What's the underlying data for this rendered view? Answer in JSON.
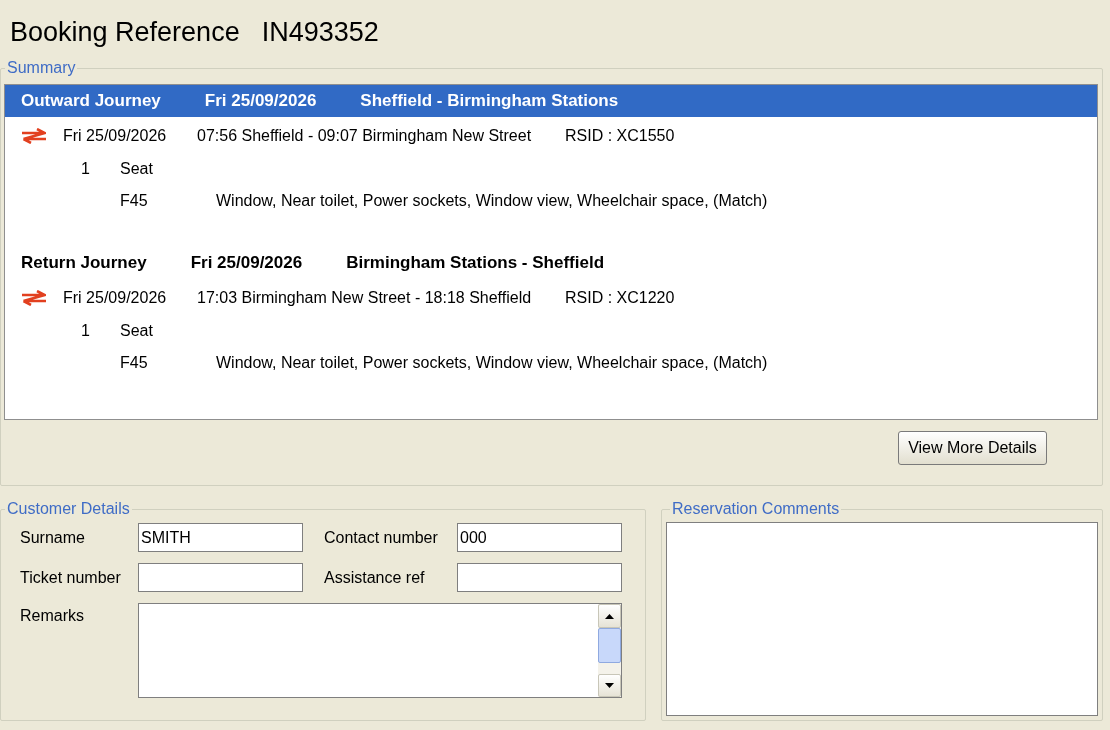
{
  "header": {
    "label": "Booking Reference",
    "value": "IN493352"
  },
  "summary": {
    "legend": "Summary",
    "journeys": [
      {
        "title": "Outward Journey",
        "date": "Fri 25/09/2026",
        "route": "Sheffield - Birmingham Stations",
        "selected": true,
        "legs": [
          {
            "date": "Fri 25/09/2026",
            "service": "07:56 Sheffield - 09:07 Birmingham New Street",
            "rsid": "RSID : XC1550",
            "quantity": "1",
            "reservation_type": "Seat",
            "seats": [
              {
                "number": "F45",
                "features": "Window, Near toilet, Power sockets, Window view, Wheelchair space, (Match)"
              }
            ]
          }
        ]
      },
      {
        "title": "Return Journey",
        "date": "Fri 25/09/2026",
        "route": "Birmingham Stations - Sheffield",
        "selected": false,
        "legs": [
          {
            "date": "Fri 25/09/2026",
            "service": "17:03 Birmingham New Street - 18:18 Sheffield",
            "rsid": "RSID : XC1220",
            "quantity": "1",
            "reservation_type": "Seat",
            "seats": [
              {
                "number": "F45",
                "features": "Window, Near toilet, Power sockets, Window view, Wheelchair space, (Match)"
              }
            ]
          }
        ]
      }
    ],
    "button": "View More Details"
  },
  "customer_details": {
    "legend": "Customer Details",
    "fields": [
      {
        "label": "Surname",
        "value": "SMITH"
      },
      {
        "label": "Contact number",
        "value": "000"
      },
      {
        "label": "Ticket number"
      },
      {
        "label": "Assistance ref"
      }
    ],
    "remarks": {
      "label": "Remarks"
    }
  },
  "reservation_comments": {
    "legend": "Reservation Comments"
  }
}
